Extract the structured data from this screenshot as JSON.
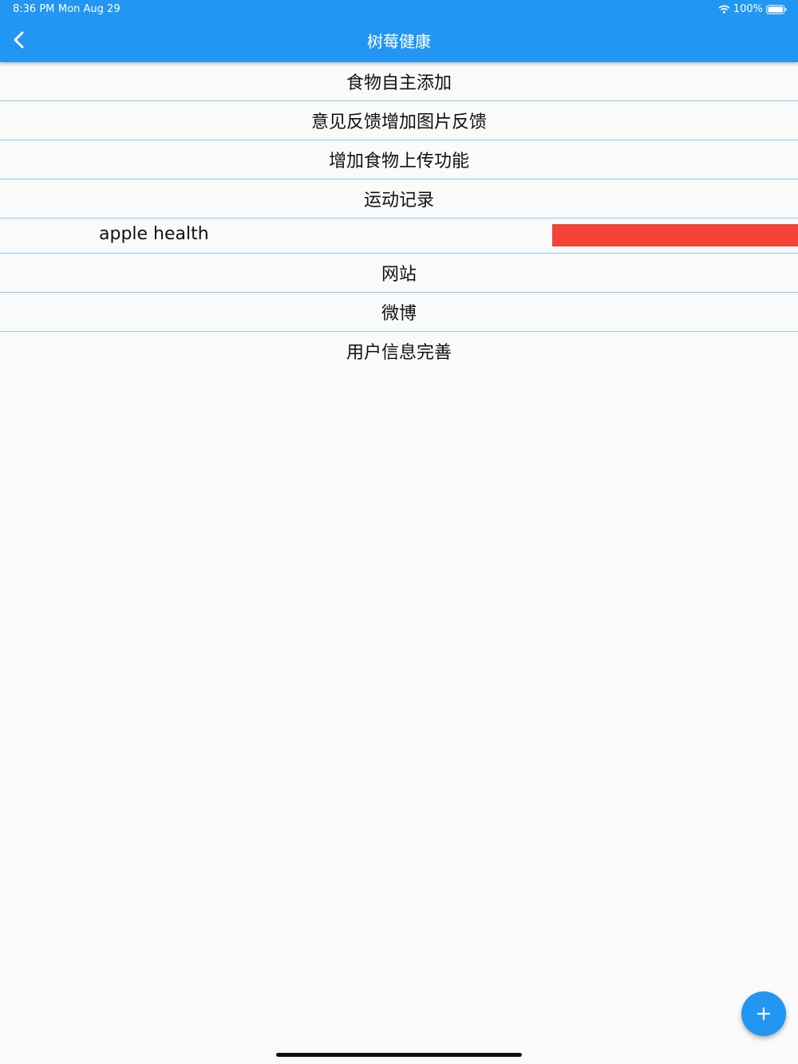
{
  "status_bar": {
    "time": "8:36 PM",
    "date": "Mon Aug 29",
    "battery": "100%"
  },
  "app_bar": {
    "title": "树莓健康"
  },
  "list": {
    "items": [
      {
        "label": "食物自主添加"
      },
      {
        "label": "意见反馈增加图片反馈"
      },
      {
        "label": "增加食物上传功能"
      },
      {
        "label": "运动记录"
      },
      {
        "label": "apple health"
      },
      {
        "label": "网站"
      },
      {
        "label": "微博"
      },
      {
        "label": "用户信息完善"
      }
    ]
  },
  "colors": {
    "app_bar": "#2196f3",
    "divider": "#90caf9",
    "delete_action": "#f44336",
    "background": "#fafafa"
  },
  "icons": {
    "back": "chevron-left-icon",
    "wifi": "wifi-icon",
    "battery": "battery-icon",
    "fab": "plus-icon"
  }
}
